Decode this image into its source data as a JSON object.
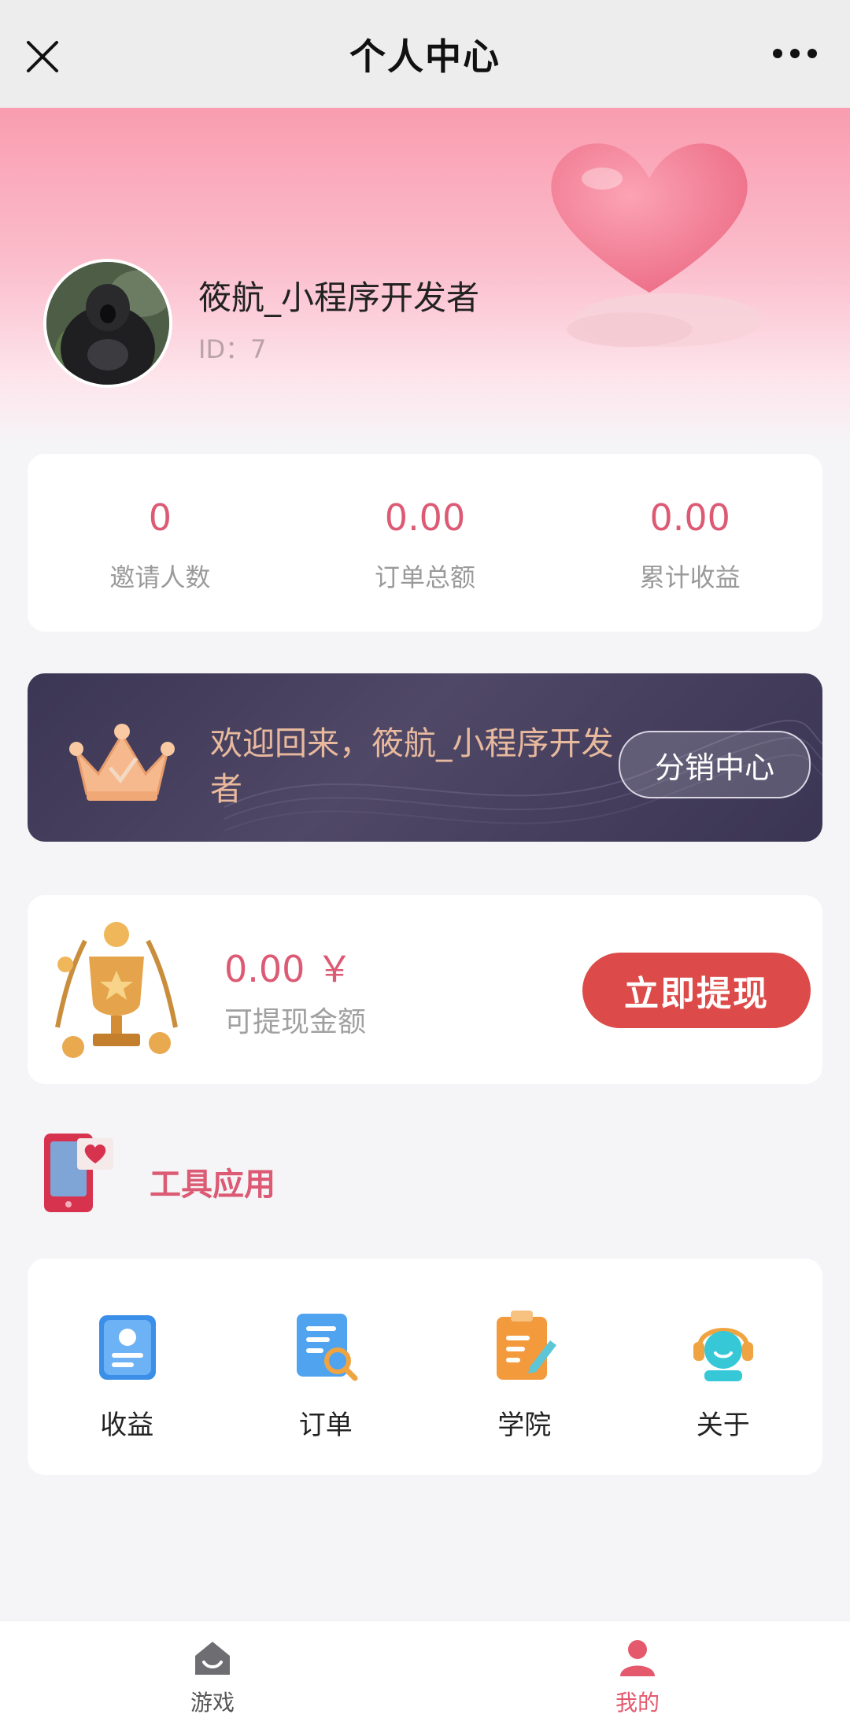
{
  "navbar": {
    "title": "个人中心",
    "close_icon": "close-icon",
    "more_icon": "more-dots-icon"
  },
  "profile": {
    "name": "筱航_小程序开发者",
    "id_text": "ID：7"
  },
  "stats": [
    {
      "value": "0",
      "label": "邀请人数"
    },
    {
      "value": "0.00",
      "label": "订单总额"
    },
    {
      "value": "0.00",
      "label": "累计收益"
    }
  ],
  "vip": {
    "welcome": "欢迎回来，筱航_小程序开发者",
    "button_label": "分销中心"
  },
  "wallet": {
    "amount": "0.00 ￥",
    "label": "可提现金额",
    "button_label": "立即提现"
  },
  "tools": {
    "title": "工具应用",
    "items": [
      {
        "label": "收益",
        "icon": "earnings-icon"
      },
      {
        "label": "订单",
        "icon": "order-search-icon"
      },
      {
        "label": "学院",
        "icon": "clipboard-icon"
      },
      {
        "label": "关于",
        "icon": "customer-service-icon"
      }
    ]
  },
  "tabbar": {
    "items": [
      {
        "label": "游戏",
        "icon": "home-game-icon",
        "active": false
      },
      {
        "label": "我的",
        "icon": "user-icon",
        "active": true
      }
    ],
    "active_color": "#e5596d",
    "inactive_color": "#555555"
  },
  "colors": {
    "accent": "#dc5a74",
    "withdraw": "#dc4b4a",
    "nav_bg": "#ededed"
  }
}
